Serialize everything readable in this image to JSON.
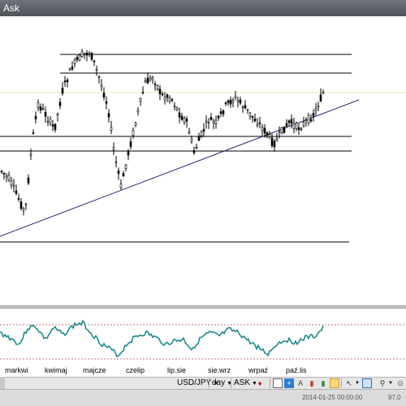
{
  "window": {
    "title": "Ask"
  },
  "toolbar": {
    "instrument": "USD/JPY",
    "period": "day",
    "side": "ASK"
  },
  "xaxis": {
    "labels": [
      "markwi",
      "kwimaj",
      "majcze",
      "czelip",
      "lip.sie",
      "sie.wrz",
      "wrpaź",
      "paź.lis"
    ]
  },
  "status": {
    "datetime": "2014-01-25 00:00:00",
    "price": "97,0"
  },
  "colors": {
    "candle": "#000000",
    "trendline": "#2b2b6e",
    "hlines": "#000000",
    "oscillator": "#1f8a8a",
    "osc_level": "#c77777",
    "titlebar": "#5c6168"
  }
}
